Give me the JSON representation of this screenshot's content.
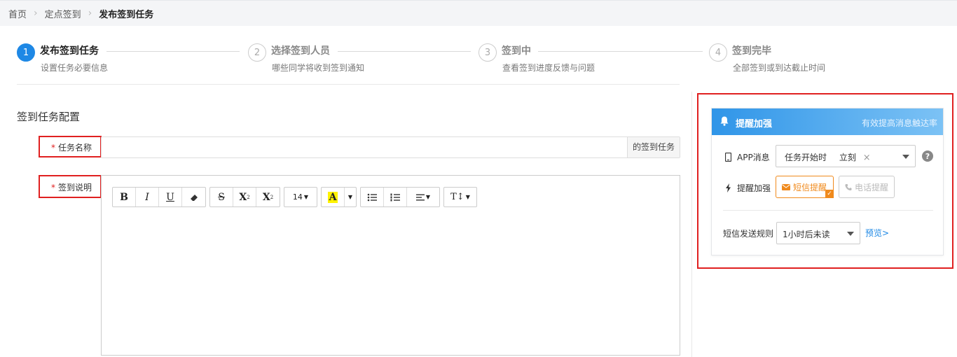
{
  "breadcrumb": {
    "items": [
      "首页",
      "定点签到",
      "发布签到任务"
    ]
  },
  "steps": [
    {
      "num": "1",
      "title": "发布签到任务",
      "desc": "设置任务必要信息",
      "active": true
    },
    {
      "num": "2",
      "title": "选择签到人员",
      "desc": "哪些同学将收到签到通知",
      "active": false
    },
    {
      "num": "3",
      "title": "签到中",
      "desc": "查看签到进度反馈与问题",
      "active": false
    },
    {
      "num": "4",
      "title": "签到完毕",
      "desc": "全部签到或到达截止时间",
      "active": false
    }
  ],
  "form": {
    "section_title": "签到任务配置",
    "required_mark": "*",
    "name_label": "任务名称",
    "name_value": "",
    "name_suffix": "的签到任务",
    "desc_label": "签到说明",
    "toolbar": {
      "bold": "B",
      "italic": "I",
      "underline": "U",
      "strike": "S",
      "superscript": "X",
      "superscript_mark": "2",
      "subscript": "X",
      "subscript_mark": "2",
      "font_size": "14",
      "font_color": "A",
      "text_size": "T↕"
    }
  },
  "reminder": {
    "title": "提醒加强",
    "subtitle": "有效提高消息触达率",
    "app_label": "APP消息",
    "app_select_value": "任务开始时",
    "app_tag": "立刻",
    "app_tag_close": "×",
    "help": "?",
    "enhance_label": "提醒加强",
    "sms_button": "短信提醒",
    "phone_button": "电话提醒",
    "rule_label": "短信发送规则",
    "rule_select_value": "1小时后未读",
    "preview_link": "预览>"
  },
  "colors": {
    "accent": "#1e88e5",
    "highlight_red": "#e02020",
    "sms_orange": "#f08a1c"
  }
}
